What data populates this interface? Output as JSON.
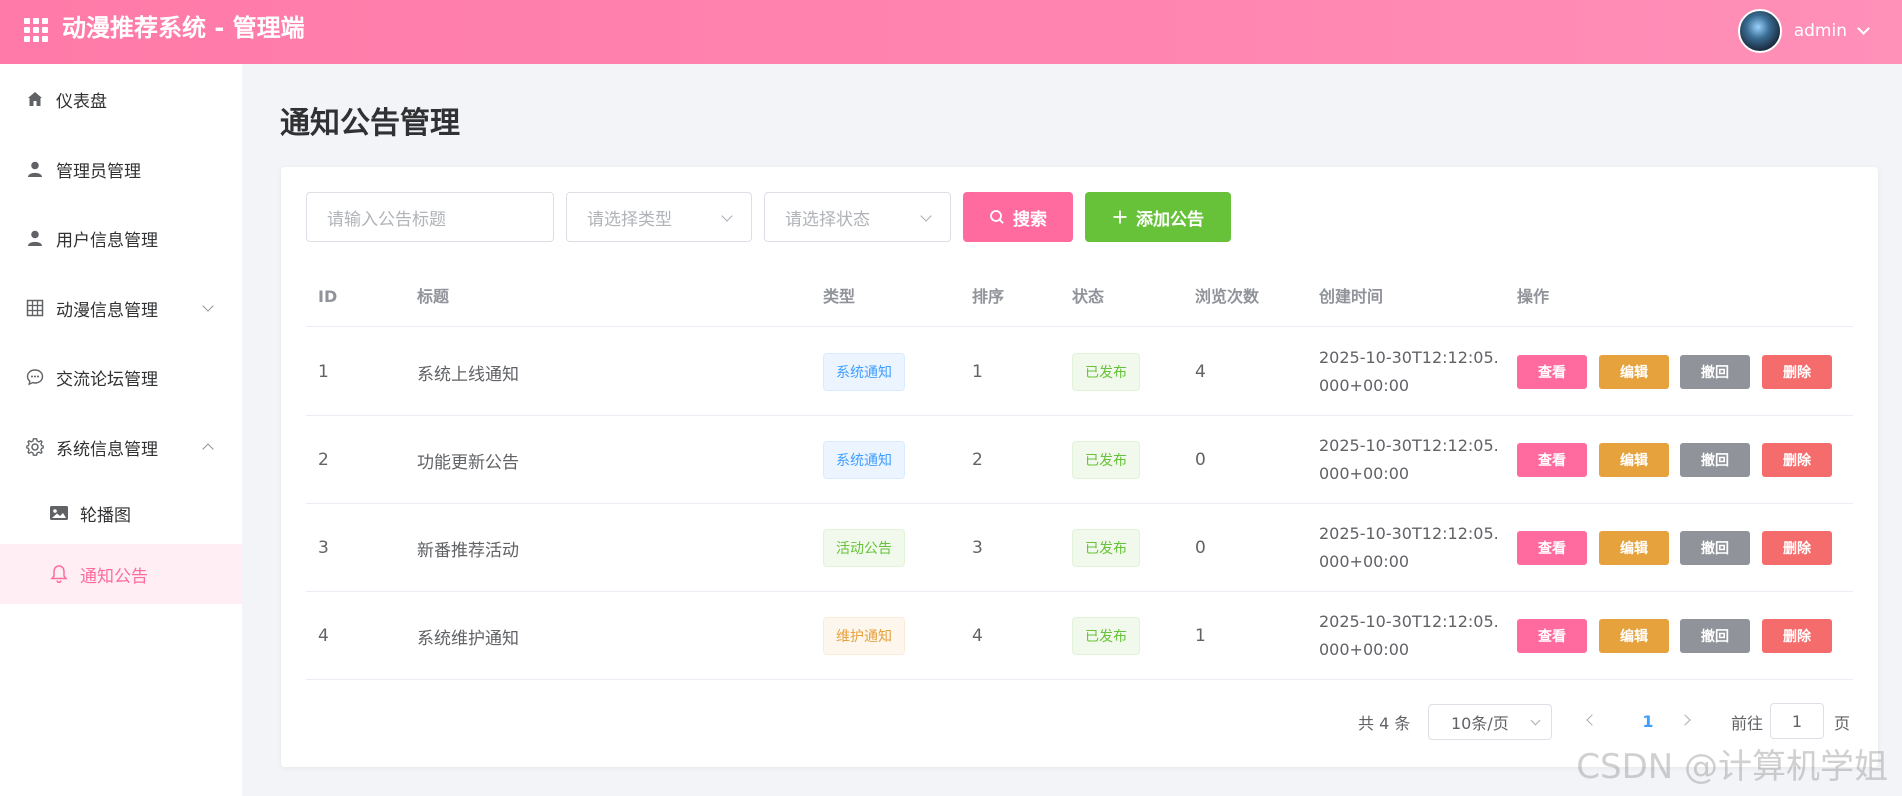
{
  "header": {
    "app_title": "动漫推荐系统 - 管理端",
    "username": "admin"
  },
  "sidebar": {
    "items": [
      {
        "label": "仪表盘",
        "icon": "home-icon"
      },
      {
        "label": "管理员管理",
        "icon": "user-icon"
      },
      {
        "label": "用户信息管理",
        "icon": "user-icon"
      },
      {
        "label": "动漫信息管理",
        "icon": "grid-table-icon",
        "expandable": true,
        "expanded": false
      },
      {
        "label": "交流论坛管理",
        "icon": "chat-bubble-icon"
      },
      {
        "label": "系统信息管理",
        "icon": "gear-icon",
        "expandable": true,
        "expanded": true
      }
    ],
    "sub_items": [
      {
        "label": "轮播图",
        "icon": "image-icon",
        "active": false
      },
      {
        "label": "通知公告",
        "icon": "bell-icon",
        "active": true
      }
    ]
  },
  "page": {
    "title": "通知公告管理"
  },
  "filters": {
    "title_placeholder": "请输入公告标题",
    "type_placeholder": "请选择类型",
    "status_placeholder": "请选择状态",
    "search_label": "搜索",
    "add_label": "添加公告"
  },
  "table": {
    "columns": [
      "ID",
      "标题",
      "类型",
      "排序",
      "状态",
      "浏览次数",
      "创建时间",
      "操作"
    ],
    "rows": [
      {
        "id": "1",
        "title": "系统上线通知",
        "type": "系统通知",
        "type_color": "blue",
        "sort": "1",
        "status": "已发布",
        "views": "4",
        "created": "2025-10-30T12:12:05.000+00:00"
      },
      {
        "id": "2",
        "title": "功能更新公告",
        "type": "系统通知",
        "type_color": "blue",
        "sort": "2",
        "status": "已发布",
        "views": "0",
        "created": "2025-10-30T12:12:05.000+00:00"
      },
      {
        "id": "3",
        "title": "新番推荐活动",
        "type": "活动公告",
        "type_color": "green",
        "sort": "3",
        "status": "已发布",
        "views": "0",
        "created": "2025-10-30T12:12:05.000+00:00"
      },
      {
        "id": "4",
        "title": "系统维护通知",
        "type": "维护通知",
        "type_color": "orange",
        "sort": "4",
        "status": "已发布",
        "views": "1",
        "created": "2025-10-30T12:12:05.000+00:00"
      }
    ],
    "actions": {
      "view": "查看",
      "edit": "编辑",
      "revoke": "撤回",
      "delete": "删除"
    }
  },
  "pagination": {
    "total_text": "共 4 条",
    "page_size": "10条/页",
    "current_page": "1",
    "goto_prefix": "前往",
    "goto_value": "1",
    "goto_suffix": "页"
  },
  "watermark": "CSDN @计算机学姐",
  "colors": {
    "accent": "#ff6b9e",
    "header_gradient_start": "#ff7aa8",
    "success": "#67c23a",
    "warning": "#e6a23c",
    "info": "#909399",
    "danger": "#f56c6c"
  }
}
